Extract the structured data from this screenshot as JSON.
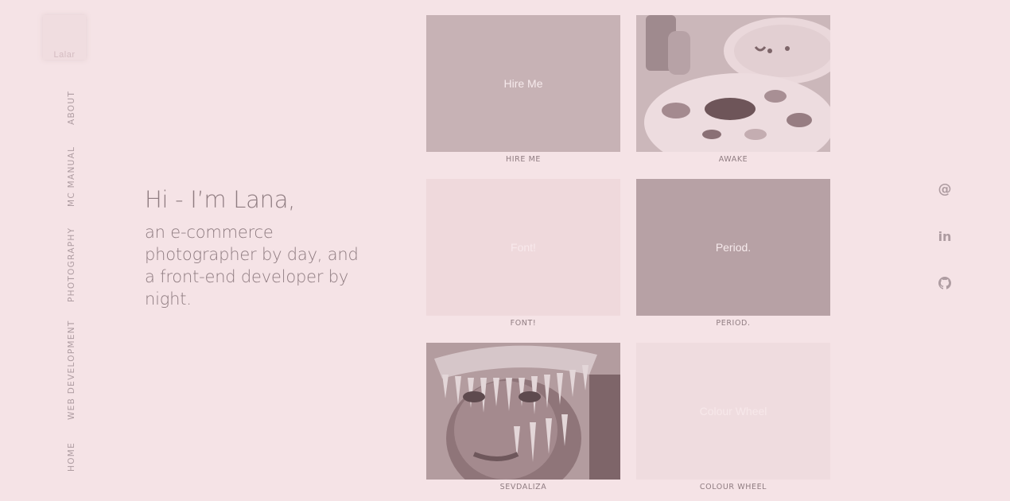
{
  "logo": {
    "text": "Lalar"
  },
  "nav": {
    "items": [
      {
        "label": "ABOUT"
      },
      {
        "label": "MC MANUAL"
      },
      {
        "label": "PHOTOGRAPHY"
      },
      {
        "label": "WEB DEVELOPMENT"
      },
      {
        "label": "HOME"
      }
    ]
  },
  "intro": {
    "greeting": "Hi - I’m Lana,",
    "tagline": "an e-commerce photographer by day, and a front-end developer by night."
  },
  "projects": [
    {
      "overlay": "Hire Me",
      "caption": "HIRE ME"
    },
    {
      "overlay": "",
      "caption": "AWAKE"
    },
    {
      "overlay": "Font!",
      "caption": "FONT!"
    },
    {
      "overlay": "Period.",
      "caption": "PERIOD."
    },
    {
      "overlay": "",
      "caption": "SEVDALIZA"
    },
    {
      "overlay": "Colour Wheel",
      "caption": "COLOUR WHEEL"
    }
  ],
  "social": {
    "email_icon": "at-icon",
    "linkedin_icon": "linkedin-icon",
    "github_icon": "github-icon",
    "email_glyph": "@",
    "linkedin_glyph": "in"
  },
  "colors": {
    "background": "#f5e3e6",
    "text": "#8f7c81",
    "nav_text": "#ae9ca1"
  }
}
